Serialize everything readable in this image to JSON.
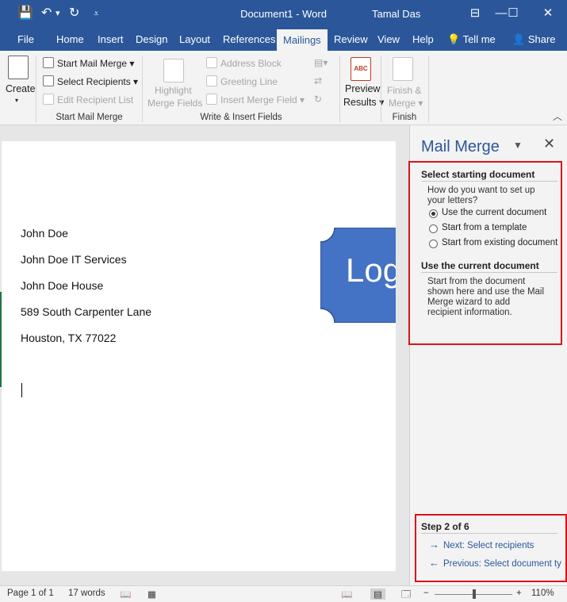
{
  "window": {
    "title": "Document1 - Word",
    "user": "Tamal Das",
    "quick_access": {
      "save": "💾",
      "undo": "↶",
      "undo_dropdown": "▾",
      "repeat": "↻",
      "customize": "⩡"
    },
    "controls": {
      "minimize": "—",
      "maximize": "☐",
      "close": "✕"
    }
  },
  "tabs": [
    {
      "label": "File"
    },
    {
      "label": "Home"
    },
    {
      "label": "Insert"
    },
    {
      "label": "Design"
    },
    {
      "label": "Layout"
    },
    {
      "label": "References"
    },
    {
      "label": "Mailings"
    },
    {
      "label": "Review"
    },
    {
      "label": "View"
    },
    {
      "label": "Help"
    },
    {
      "label": "Tell me"
    },
    {
      "label": "Share"
    }
  ],
  "ribbon": {
    "create": {
      "label": "Create",
      "caret": "▾"
    },
    "start_mail_merge": {
      "start": "Start Mail Merge ▾",
      "select": "Select Recipients ▾",
      "edit": "Edit Recipient List",
      "group": "Start Mail Merge"
    },
    "write_insert": {
      "highlight_1": "Highlight",
      "highlight_2": "Merge Fields",
      "address": "Address Block",
      "greeting": "Greeting Line",
      "insert_field": "Insert Merge Field",
      "insert_caret": "▾",
      "group": "Write & Insert Fields"
    },
    "preview": {
      "line1": "Preview",
      "line2": "Results ▾",
      "icon_text": "ABC"
    },
    "finish": {
      "line1": "Finish &",
      "line2": "Merge ▾",
      "group": "Finish"
    },
    "collapse": "︿"
  },
  "document": {
    "lines": [
      "John Doe",
      "John Doe IT Services",
      "John Doe House",
      "589 South Carpenter Lane",
      "Houston, TX 77022"
    ],
    "logo_text": "Log"
  },
  "pane": {
    "title": "Mail Merge",
    "dropdown": "▼",
    "close": "✕",
    "select_heading": "Select starting document",
    "question_1": "How do you want to set up",
    "question_2": "your letters?",
    "options": [
      "Use the current document",
      "Start from a template",
      "Start from existing document"
    ],
    "use_heading": "Use the current document",
    "desc": [
      "Start from the document",
      "shown here and use the Mail",
      "Merge wizard to add",
      "recipient information."
    ],
    "step": "Step 2 of 6",
    "next": "Next: Select recipients",
    "previous": "Previous: Select document ty",
    "next_arrow": "→",
    "prev_arrow": "←"
  },
  "status": {
    "page": "Page 1 of 1",
    "words": "17 words",
    "proof_icon": "📖",
    "macro_icon": "▦",
    "view_read": "📖",
    "view_print": "▤",
    "view_web": "🗔",
    "zoom_minus": "−",
    "zoom_plus": "+",
    "zoom": "110%"
  }
}
